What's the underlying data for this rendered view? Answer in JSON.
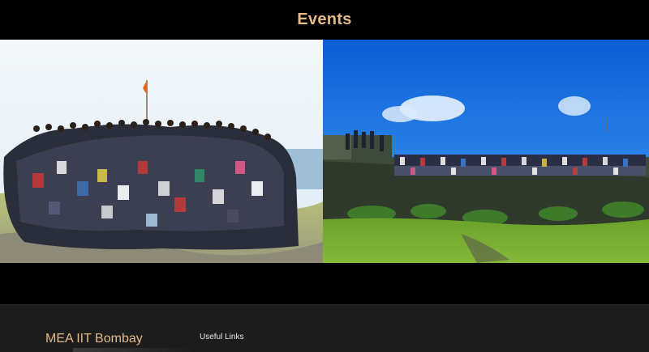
{
  "events": {
    "title": "Events"
  },
  "gallery": {
    "photos": [
      {
        "alt": "Group photo of students on a hilltop with a saffron flag"
      },
      {
        "alt": "Group photo of students on a fort wall under blue sky"
      }
    ]
  },
  "footer": {
    "brand": "MEA IIT Bombay",
    "links_heading": "Useful Links"
  },
  "colors": {
    "accent": "#e3b988",
    "background": "#000000",
    "footer_bg": "#1c1c1c"
  }
}
